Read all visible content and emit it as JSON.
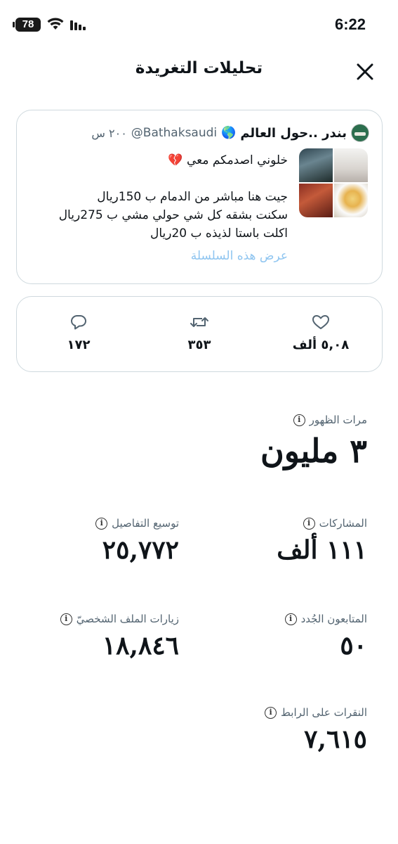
{
  "status_bar": {
    "battery": "78",
    "time": "6:22"
  },
  "header": {
    "title": "تحليلات التغريدة"
  },
  "tweet": {
    "author_name": "بندر ..حول العالم",
    "handle": "@Bathaksaudi",
    "time": "٢٠٠ س",
    "lines": [
      "خلوني اصدمكم معي 💔",
      "",
      "جيت هنا مباشر من الدمام ب 150ريال",
      "سكنت بشقه كل شي حولي مشي ب 275ريال",
      "اكلت باستا لذيذه ب 20ريال"
    ],
    "show_thread": "عرض هذه السلسلة"
  },
  "stats": {
    "likes": "٥,٠٨ ألف",
    "retweets": "٣٥٣",
    "replies": "١٧٢"
  },
  "metrics": {
    "impressions": {
      "label": "مرات الظهور",
      "value": "٣ مليون"
    },
    "engagements": {
      "label": "المشاركات",
      "value": "١١١ ألف"
    },
    "detail_expands": {
      "label": "توسيع التفاصيل",
      "value": "٢٥,٧٧٢"
    },
    "new_followers": {
      "label": "المتابعون الجُدد",
      "value": "٥٠"
    },
    "profile_visits": {
      "label": "زيارات الملف الشخصيّ",
      "value": "١٨,٨٤٦"
    },
    "link_clicks": {
      "label": "النقرات على الرابط",
      "value": "٧,٦١٥"
    }
  },
  "icons": {
    "close": "close-icon",
    "like": "heart-icon",
    "retweet": "retweet-icon",
    "reply": "reply-icon",
    "info": "info-icon",
    "globe": "globe-icon"
  },
  "colors": {
    "link": "#8fc5f0",
    "border": "#cfd9de",
    "muted": "#536471",
    "text": "#0f1419"
  }
}
